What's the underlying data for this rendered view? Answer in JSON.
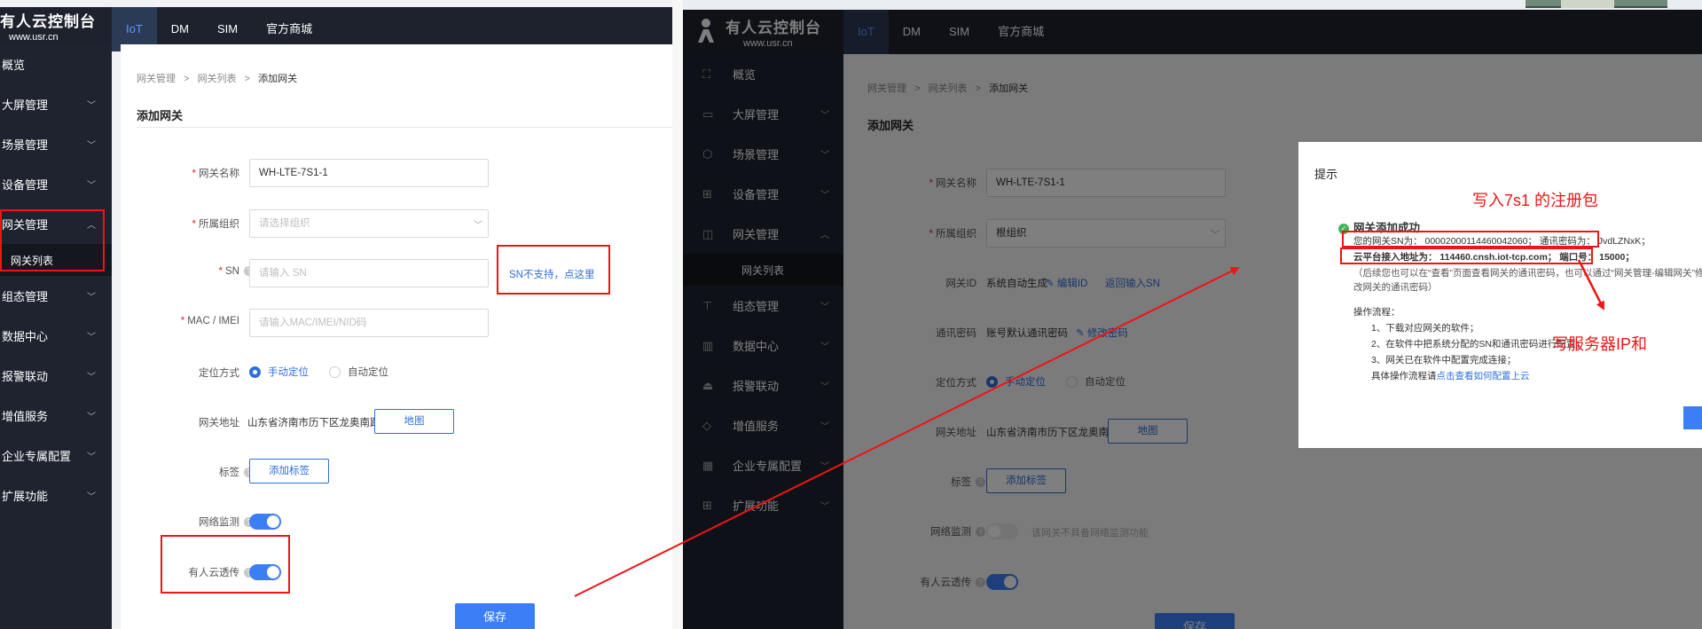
{
  "app": {
    "logo_title": "有人云控制台",
    "logo_sub": "www.usr.cn",
    "top_tabs": [
      "IoT",
      "DM",
      "SIM",
      "官方商城"
    ]
  },
  "sidebar": {
    "items": [
      "概览",
      "大屏管理",
      "场景管理",
      "设备管理",
      "网关管理",
      "组态管理",
      "数据中心",
      "报警联动",
      "增值服务",
      "企业专属配置",
      "扩展功能"
    ],
    "sub_item": "网关列表"
  },
  "breadcrumb": {
    "items": [
      "网关管理",
      "网关列表",
      "添加网关"
    ],
    "sep": ">"
  },
  "page_title": "添加网关",
  "form": {
    "name_label": "网关名称",
    "name_value": "WH-LTE-7S1-1",
    "org_label": "所属组织",
    "org_placeholder": "请选择组织",
    "org_value_right": "根组织",
    "sn_label": "SN",
    "sn_placeholder": "请输入 SN",
    "sn_hint": "SN不支持，点这里",
    "mac_label": "MAC / IMEI",
    "mac_placeholder": "请输入MAC/IMEI/NID码",
    "gwid_label": "网关ID",
    "gwid_value": "系统自动生成",
    "gwid_edit": "编辑ID",
    "gwid_back": "返回输入SN",
    "pwd_label": "通讯密码",
    "pwd_value": "账号默认通讯密码",
    "pwd_edit": "修改密码",
    "loc_label": "定位方式",
    "loc_manual": "手动定位",
    "loc_auto": "自动定位",
    "addr_label": "网关地址",
    "addr_value": "山东省济南市历下区龙奥南路",
    "map_btn": "地图",
    "tag_label": "标签",
    "tag_btn": "添加标签",
    "net_label": "网络监测",
    "net_disabled_hint": "该网关不具备网络监测功能",
    "cloud_label": "有人云透传",
    "save_btn": "保存"
  },
  "dialog": {
    "title": "提示",
    "success": "网关添加成功",
    "line1": "您的网关SN为：  00002000114460042060；  通讯密码为：  JvdLZNxK；",
    "line2": "云平台接入地址为：  114460.cnsh.iot-tcp.com；  端口号：  15000；",
    "line3": "（后续您也可以在“查看”页面查看网关的通讯密码，也可以通过“网关管理-编辑网关”修",
    "line4": "改网关的通讯密码）",
    "flow_title": "操作流程：",
    "step1": "1、下载对应网关的软件；",
    "step2": "2、在软件中把系统分配的SN和通讯密码进行配置；",
    "step3": "3、网关已在软件中配置完成连接；",
    "step4_prefix": "具体操作流程请",
    "step4_link": "点击查看如何配置上云"
  },
  "annotations": {
    "register_pkg": "写入7s1 的注册包",
    "server_ip": "写服务器IP和"
  },
  "colors": {
    "accent": "#3a7ff6",
    "sidebar_bg": "#1f2330",
    "topbar_bg": "#1e222d",
    "annotation": "#f01414"
  }
}
